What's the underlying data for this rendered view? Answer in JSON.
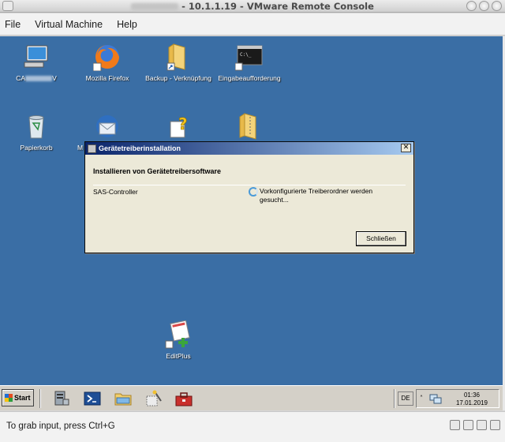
{
  "window": {
    "title": "- 10.1.1.19 - VMware Remote Console"
  },
  "menu": {
    "file": "File",
    "vm": "Virtual Machine",
    "help": "Help"
  },
  "desktop_icons": [
    {
      "name": "computer",
      "label_suffix": "V",
      "label_prefix": "CA"
    },
    {
      "name": "firefox",
      "label": "Mozilla Firefox"
    },
    {
      "name": "backup",
      "label": "Backup - Verknüpfung"
    },
    {
      "name": "cmd",
      "label": "Eingabeaufforderung"
    },
    {
      "name": "recycle",
      "label": "Papierkorb"
    },
    {
      "name": "thunderbird",
      "label": "M"
    },
    {
      "name": "editplus",
      "label": "EditPlus"
    }
  ],
  "dialog": {
    "title": "Gerätetreiberinstallation",
    "heading": "Installieren von Gerätetreibersoftware",
    "device": "SAS-Controller",
    "status": "Vorkonfigurierte Treiberordner werden gesucht...",
    "close_button": "Schließen",
    "close_x": "✕"
  },
  "taskbar": {
    "start_label": "Start",
    "language": "DE",
    "time": "01:36",
    "date": "17.01.2019"
  },
  "statusbar": {
    "text": "To grab input, press Ctrl+G"
  },
  "colors": {
    "desktop": "#3a6ea5",
    "dialog_title_start": "#0a246a",
    "dialog_title_end": "#a6caf0"
  }
}
